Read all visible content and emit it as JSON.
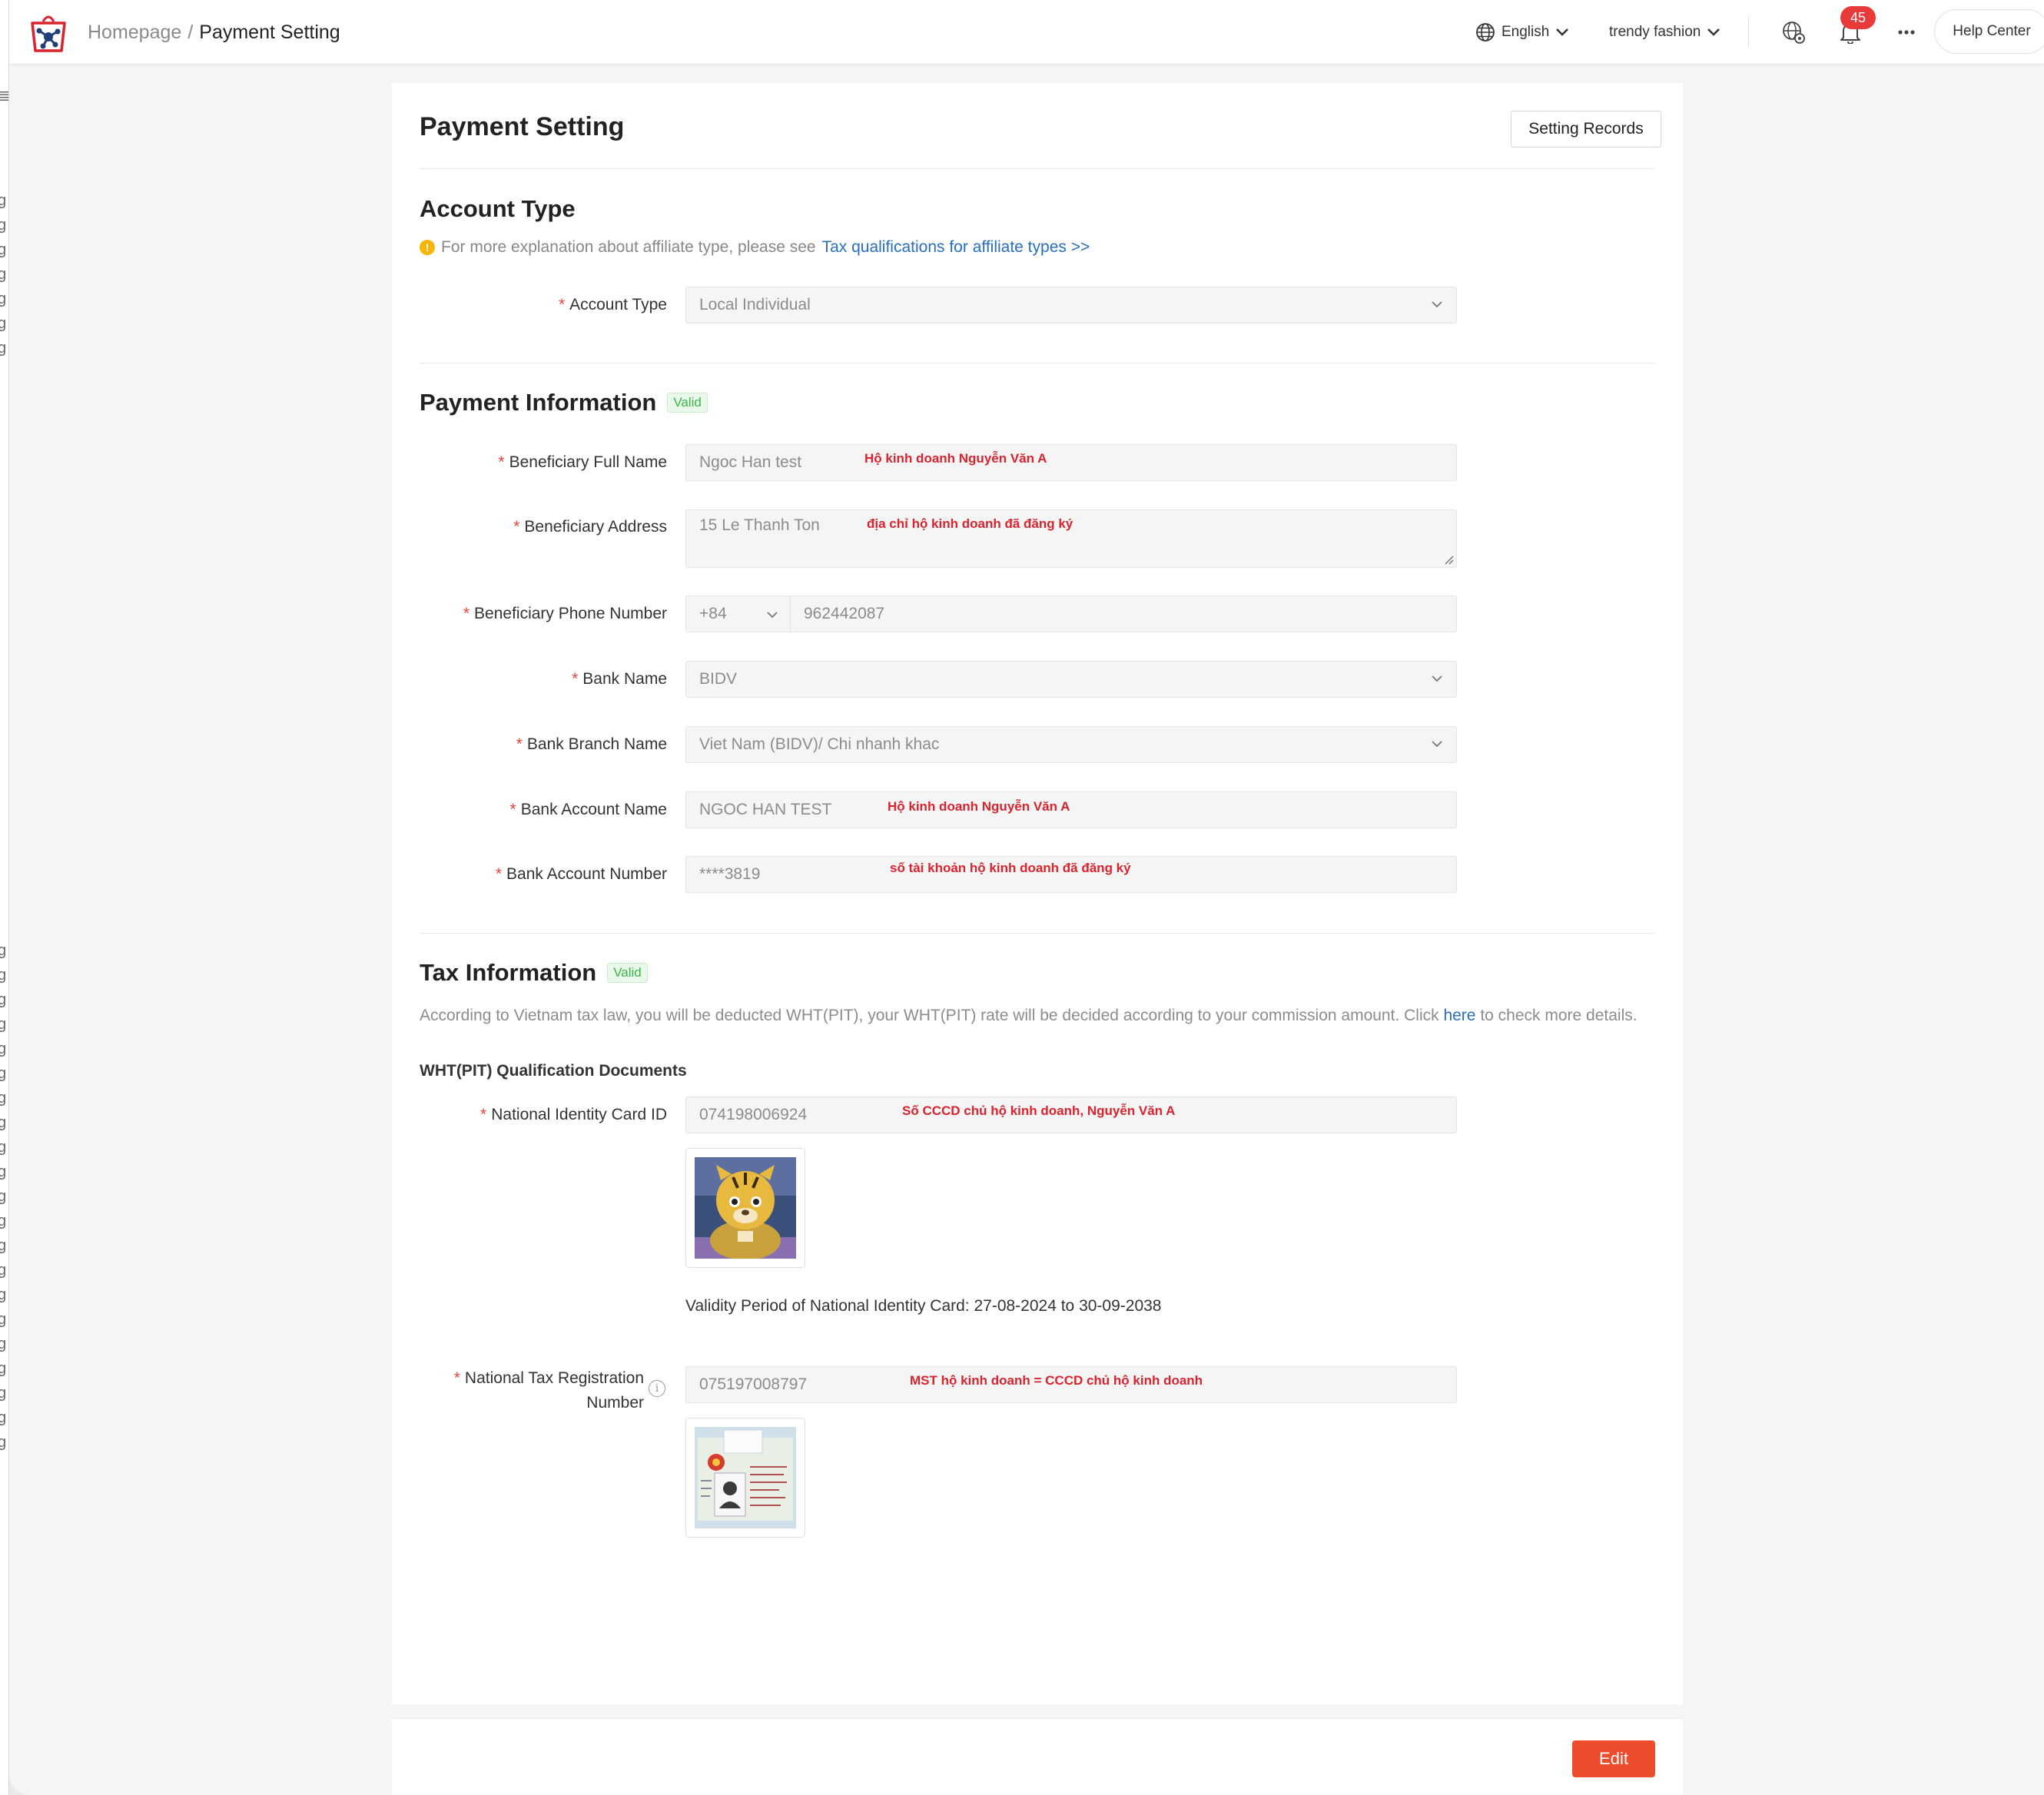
{
  "header": {
    "breadcrumb_home": "Homepage",
    "breadcrumb_sep": "/",
    "breadcrumb_current": "Payment Setting",
    "language": "English",
    "shop": "trendy fashion",
    "notification_count": "45",
    "help": "Help Center"
  },
  "page": {
    "title": "Payment Setting",
    "records_button": "Setting Records",
    "edit_button": "Edit"
  },
  "account_type": {
    "section_title": "Account Type",
    "hint_prefix": "For more explanation about affiliate type, please see",
    "hint_link": "Tax qualifications for affiliate types >>",
    "label": "Account Type",
    "value": "Local Individual"
  },
  "payment": {
    "section_title": "Payment Information",
    "status": "Valid",
    "full_name_label": "Beneficiary Full Name",
    "full_name_value": "Ngoc Han test",
    "full_name_note": "Hộ kinh doanh Nguyễn Văn A",
    "address_label": "Beneficiary Address",
    "address_value": "15 Le Thanh Ton",
    "address_note": "địa chỉ hộ kinh doanh đã đăng ký",
    "phone_label": "Beneficiary Phone Number",
    "phone_prefix": "+84",
    "phone_value": "962442087",
    "bank_label": "Bank Name",
    "bank_value": "BIDV",
    "branch_label": "Bank Branch Name",
    "branch_value": "Viet Nam (BIDV)/ Chi nhanh khac",
    "account_name_label": "Bank Account Name",
    "account_name_value": "NGOC HAN TEST",
    "account_name_note": "Hộ kinh doanh Nguyễn Văn A",
    "account_number_label": "Bank Account Number",
    "account_number_value": "****3819",
    "account_number_note": "số tài khoản hộ kinh doanh đã đăng ký"
  },
  "tax": {
    "section_title": "Tax Information",
    "status": "Valid",
    "desc_prefix": "According to Vietnam tax law, you will be deducted WHT(PIT), your WHT(PIT) rate will be decided according to your commission amount. Click",
    "desc_link": "here",
    "desc_suffix": "to check more details.",
    "docs_title": "WHT(PIT) Qualification Documents",
    "id_label": "National Identity Card ID",
    "id_value": "074198006924",
    "id_note": "Số CCCD chủ hộ kinh doanh, Nguyễn Văn A",
    "validity": "Validity Period of National Identity Card: 27-08-2024 to 30-09-2038",
    "tax_label_line1": "National Tax Registration",
    "tax_label_line2": "Number",
    "tax_value": "075197008797",
    "tax_note": "MST hộ kinh doanh = CCCD chủ hộ kinh doanh"
  },
  "colors": {
    "accent": "#ee4d2d",
    "link": "#2a6fbf",
    "valid": "#3bb54a",
    "required": "#e8453c",
    "annotation": "#d9232d"
  }
}
